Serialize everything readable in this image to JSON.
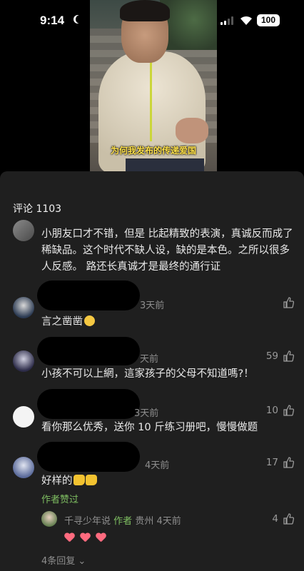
{
  "status_bar": {
    "time": "9:14",
    "battery": "100"
  },
  "video": {
    "subtitle": "为何我发布的传递爱国"
  },
  "comments_panel": {
    "title": "评论 1103",
    "comments": [
      {
        "name": "",
        "body": "小朋友口才不错，但是 比起精致的表演，真诚反而成了稀缺品。这个时代不缺人设，缺的是本色。之所以很多人反感。 路还长真诚才是最终的通行证",
        "time": "",
        "likes": ""
      },
      {
        "name": "",
        "body": "言之凿凿",
        "time": "3天前",
        "likes": ""
      },
      {
        "name": "",
        "body": "小孩不可以上網，這家孩子的父母不知道嗎?！",
        "time": "天前",
        "likes": "59"
      },
      {
        "name": "",
        "body": "看你那么优秀，送你 10 斤练习册吧，慢慢做题",
        "time": "3天前",
        "likes": "10"
      },
      {
        "name": "",
        "body": "好样的",
        "time": "4天前",
        "likes": "17",
        "author_liked": "作者赞过"
      }
    ],
    "reply": {
      "name": "千寻少年说",
      "tag": "作者",
      "location": "贵州",
      "time": "4天前",
      "likes": "4"
    },
    "more_replies": "4条回复"
  },
  "colors": {
    "sheet_bg": "#1f1f1f",
    "muted": "#8e8e8e",
    "accent_green": "#7fbf62",
    "subtitle_yellow": "#ffe14a"
  }
}
